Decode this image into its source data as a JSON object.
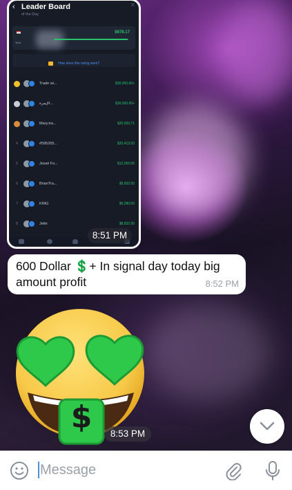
{
  "leaderboard": {
    "title": "Leader Board",
    "subtitle": "of the Day",
    "card_amount": "$678.17",
    "card_you": "Your",
    "card_progress": 0.97,
    "info_text": "How does this rating work?",
    "rows": [
      {
        "rank": "",
        "name": "Trade wi...",
        "amount": "$30,000.00+"
      },
      {
        "rank": "",
        "name": "الإيمرة...",
        "amount": "$30,000.00+"
      },
      {
        "rank": "",
        "name": "Mary.tra...",
        "amount": "$20,933.71"
      },
      {
        "rank": "4",
        "name": "#595265...",
        "amount": "$20,413.00"
      },
      {
        "rank": "5",
        "name": "Jessé Fo...",
        "amount": "$12,055.56"
      },
      {
        "rank": "6",
        "name": "BrianTra...",
        "amount": "$9,932.00"
      },
      {
        "rank": "7",
        "name": "KING",
        "amount": "$9,280.00"
      },
      {
        "rank": "8",
        "name": "Jetin",
        "amount": "$8,832.95"
      }
    ]
  },
  "messages": {
    "photo_time": "8:51 PM",
    "text": "600 Dollar 💲+ In signal day today big amount profit",
    "text_time": "8:52 PM",
    "sticker_symbol": "$",
    "sticker_time": "8:53 PM"
  },
  "input": {
    "placeholder": "Message"
  },
  "icons": {
    "emoji": "smile-icon",
    "attach": "paperclip-icon",
    "mic": "microphone-icon",
    "scroll": "chevron-down-icon"
  },
  "colors": {
    "profit_green": "#27c46d",
    "link_blue": "#4d8ff0",
    "bubble_white": "#ffffff",
    "sticker_yellow": "#f7c948",
    "sticker_green": "#2ec84a"
  }
}
